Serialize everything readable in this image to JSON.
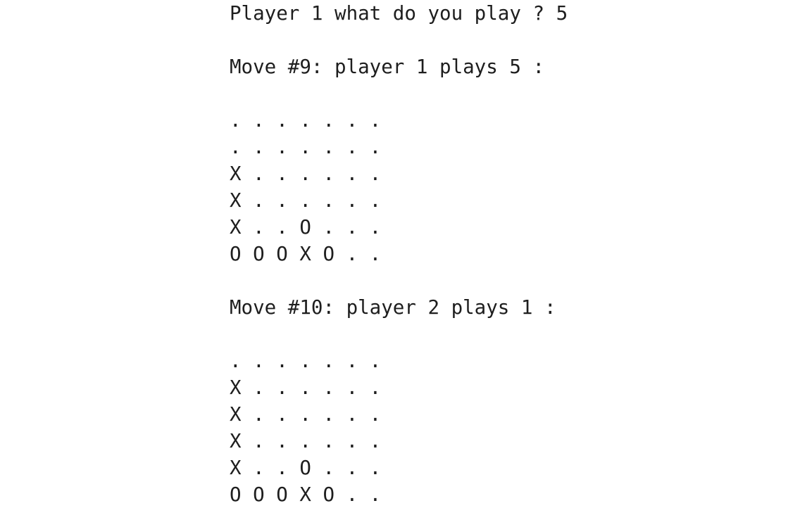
{
  "console": {
    "prompt": "Player 1 what do you play ? 5",
    "move9": {
      "header": "Move #9: player 1 plays 5 :",
      "board": [
        ". . . . . . .",
        ". . . . . . .",
        "X . . . . . .",
        "X . . . . . .",
        "X . . O . . .",
        "O O O X O . ."
      ]
    },
    "move10": {
      "header": "Move #10: player 2 plays 1 :",
      "board": [
        ". . . . . . .",
        "X . . . . . .",
        "X . . . . . .",
        "X . . . . . .",
        "X . . O . . .",
        "O O O X O . ."
      ]
    }
  }
}
